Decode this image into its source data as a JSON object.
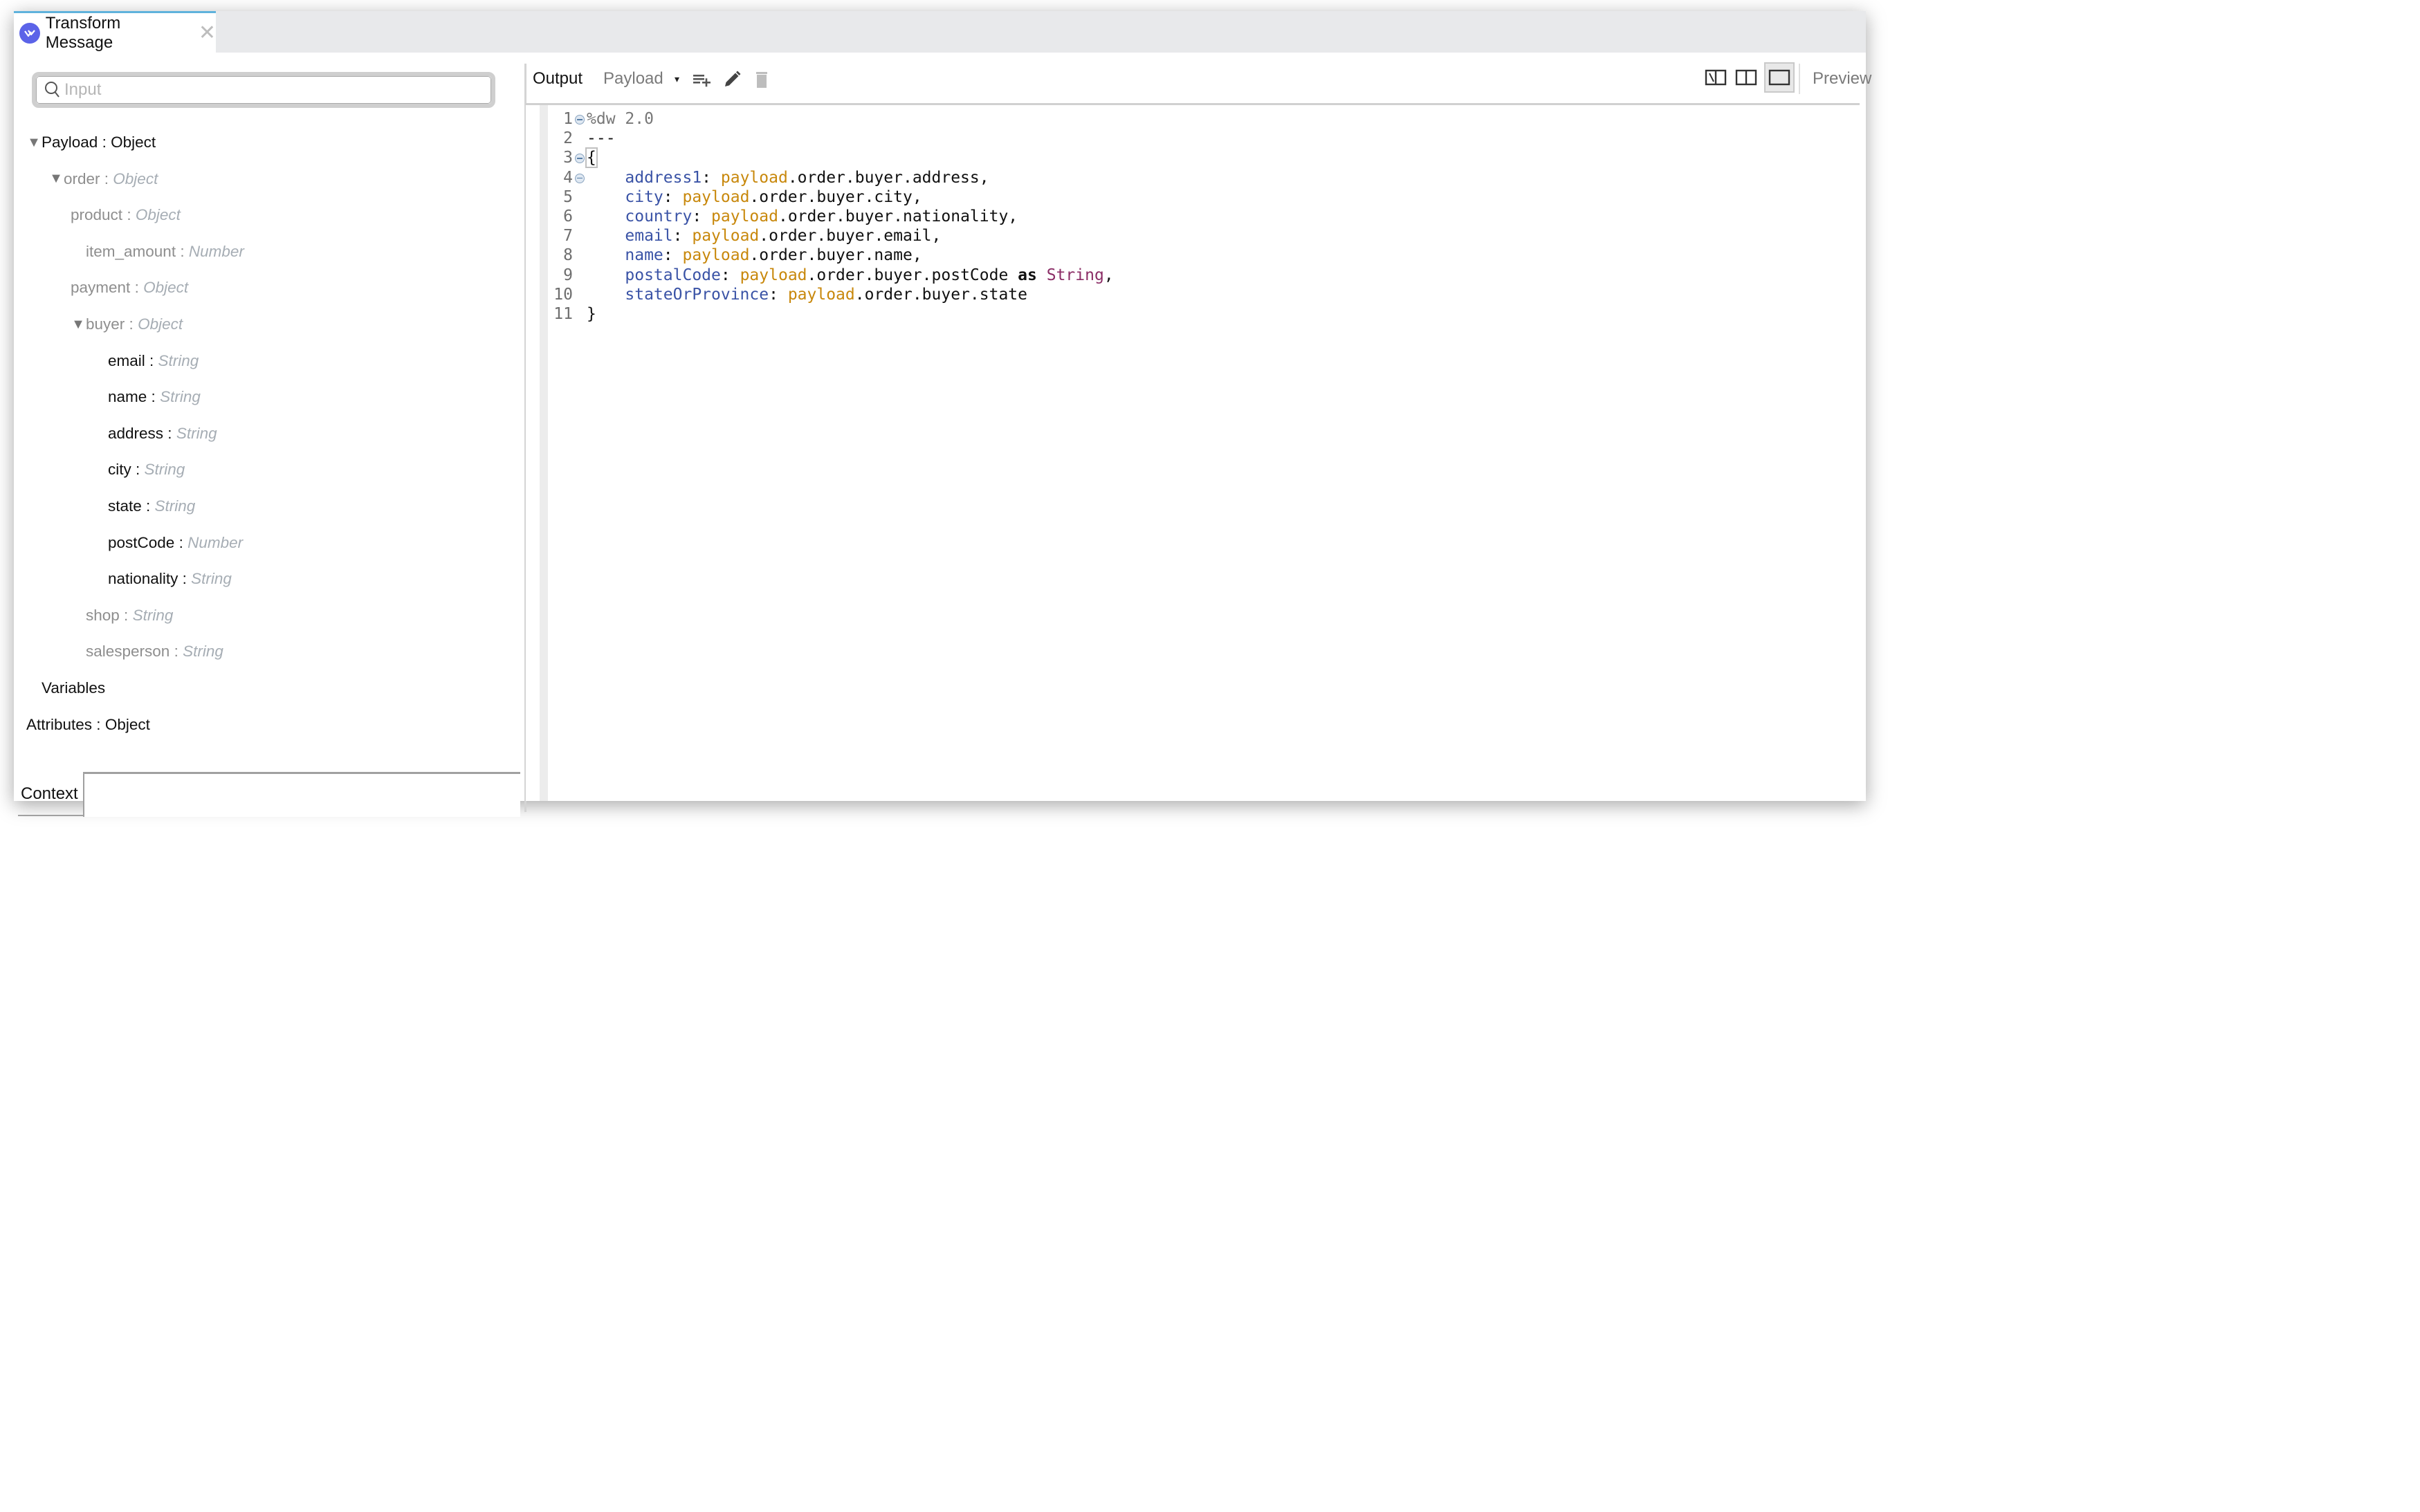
{
  "tab": {
    "title": "Transform Message",
    "icon": "mule-dataweave-logo-icon",
    "close_icon": "close-icon",
    "active_color": "#5fb2dc",
    "logo_color": "#5b63e8"
  },
  "input_panel": {
    "search": {
      "placeholder": "Input",
      "value": ""
    },
    "tree": [
      {
        "label": "Payload",
        "sep": " : ",
        "type": "Object",
        "indent": 0,
        "expander": "down",
        "style": "root"
      },
      {
        "label": "order",
        "sep": " : ",
        "type": "Object",
        "indent": 1,
        "expander": "down",
        "style": "gray"
      },
      {
        "label": "product",
        "sep": " : ",
        "type": "Object",
        "indent": 2,
        "expander": "right",
        "style": "gray"
      },
      {
        "label": "item_amount",
        "sep": " : ",
        "type": "Number",
        "indent": 2,
        "expander": "none",
        "style": "gray"
      },
      {
        "label": "payment",
        "sep": " : ",
        "type": "Object",
        "indent": 2,
        "expander": "right",
        "style": "gray"
      },
      {
        "label": "buyer",
        "sep": " : ",
        "type": "Object",
        "indent": 2,
        "expander": "down",
        "style": "gray"
      },
      {
        "label": "email",
        "sep": " : ",
        "type": "String",
        "indent": 3,
        "expander": "none",
        "style": "dark"
      },
      {
        "label": "name",
        "sep": " : ",
        "type": "String",
        "indent": 3,
        "expander": "none",
        "style": "dark"
      },
      {
        "label": "address",
        "sep": " : ",
        "type": "String",
        "indent": 3,
        "expander": "none",
        "style": "dark"
      },
      {
        "label": "city",
        "sep": " : ",
        "type": "String",
        "indent": 3,
        "expander": "none",
        "style": "dark"
      },
      {
        "label": "state",
        "sep": " : ",
        "type": "String",
        "indent": 3,
        "expander": "none",
        "style": "dark"
      },
      {
        "label": "postCode",
        "sep": " : ",
        "type": "Number",
        "indent": 3,
        "expander": "none",
        "style": "dark"
      },
      {
        "label": "nationality",
        "sep": " : ",
        "type": "String",
        "indent": 3,
        "expander": "none",
        "style": "dark"
      },
      {
        "label": "shop",
        "sep": " : ",
        "type": "String",
        "indent": 2,
        "expander": "none",
        "style": "gray"
      },
      {
        "label": "salesperson",
        "sep": " : ",
        "type": "String",
        "indent": 2,
        "expander": "none",
        "style": "gray"
      },
      {
        "label": "Variables",
        "sep": "",
        "type": "",
        "indent": 0,
        "expander": "none",
        "style": "root"
      },
      {
        "label": "Attributes",
        "sep": " : ",
        "type": "Object",
        "indent": 0,
        "expander": "right",
        "style": "root"
      }
    ],
    "context_label": "Context"
  },
  "toolbar": {
    "output_label": "Output",
    "target_label": "Payload",
    "target_caret": "▾",
    "icons": [
      "add-output-icon",
      "edit-icon",
      "delete-icon"
    ],
    "view_modes": [
      "graphics-and-source-icon",
      "split-view-icon",
      "source-only-icon"
    ],
    "active_view": "source-only-icon",
    "preview_label": "Preview"
  },
  "editor": {
    "colors": {
      "key": "#3a53a6",
      "variable": "#c8880c",
      "type": "#8b2d66",
      "directive": "#777777"
    },
    "lines": [
      {
        "n": "1",
        "fold": true,
        "tokens": [
          {
            "t": "%dw 2.0",
            "c": "dir"
          }
        ]
      },
      {
        "n": "2",
        "fold": false,
        "tokens": [
          {
            "t": "---",
            "c": ""
          }
        ]
      },
      {
        "n": "3",
        "fold": true,
        "tokens": [
          {
            "t": "{",
            "c": "brace"
          }
        ]
      },
      {
        "n": "4",
        "fold": true,
        "tokens": [
          {
            "t": "    ",
            "c": ""
          },
          {
            "t": "address1",
            "c": "key"
          },
          {
            "t": ": ",
            "c": ""
          },
          {
            "t": "payload",
            "c": "var"
          },
          {
            "t": ".order.buyer.address,",
            "c": ""
          }
        ]
      },
      {
        "n": "5",
        "fold": false,
        "tokens": [
          {
            "t": "    ",
            "c": ""
          },
          {
            "t": "city",
            "c": "key"
          },
          {
            "t": ": ",
            "c": ""
          },
          {
            "t": "payload",
            "c": "var"
          },
          {
            "t": ".order.buyer.city,",
            "c": ""
          }
        ]
      },
      {
        "n": "6",
        "fold": false,
        "tokens": [
          {
            "t": "    ",
            "c": ""
          },
          {
            "t": "country",
            "c": "key"
          },
          {
            "t": ": ",
            "c": ""
          },
          {
            "t": "payload",
            "c": "var"
          },
          {
            "t": ".order.buyer.nationality,",
            "c": ""
          }
        ]
      },
      {
        "n": "7",
        "fold": false,
        "tokens": [
          {
            "t": "    ",
            "c": ""
          },
          {
            "t": "email",
            "c": "key"
          },
          {
            "t": ": ",
            "c": ""
          },
          {
            "t": "payload",
            "c": "var"
          },
          {
            "t": ".order.buyer.email,",
            "c": ""
          }
        ]
      },
      {
        "n": "8",
        "fold": false,
        "tokens": [
          {
            "t": "    ",
            "c": ""
          },
          {
            "t": "name",
            "c": "key"
          },
          {
            "t": ": ",
            "c": ""
          },
          {
            "t": "payload",
            "c": "var"
          },
          {
            "t": ".order.buyer.name,",
            "c": ""
          }
        ]
      },
      {
        "n": "9",
        "fold": false,
        "tokens": [
          {
            "t": "    ",
            "c": ""
          },
          {
            "t": "postalCode",
            "c": "key"
          },
          {
            "t": ": ",
            "c": ""
          },
          {
            "t": "payload",
            "c": "var"
          },
          {
            "t": ".order.buyer.postCode ",
            "c": ""
          },
          {
            "t": "as",
            "c": "kw"
          },
          {
            "t": " ",
            "c": ""
          },
          {
            "t": "String",
            "c": "type"
          },
          {
            "t": ",",
            "c": ""
          }
        ]
      },
      {
        "n": "10",
        "fold": false,
        "tokens": [
          {
            "t": "    ",
            "c": ""
          },
          {
            "t": "stateOrProvince",
            "c": "key"
          },
          {
            "t": ": ",
            "c": ""
          },
          {
            "t": "payload",
            "c": "var"
          },
          {
            "t": ".order.buyer.state",
            "c": ""
          }
        ]
      },
      {
        "n": "11",
        "fold": false,
        "tokens": [
          {
            "t": "}",
            "c": ""
          }
        ]
      }
    ]
  }
}
